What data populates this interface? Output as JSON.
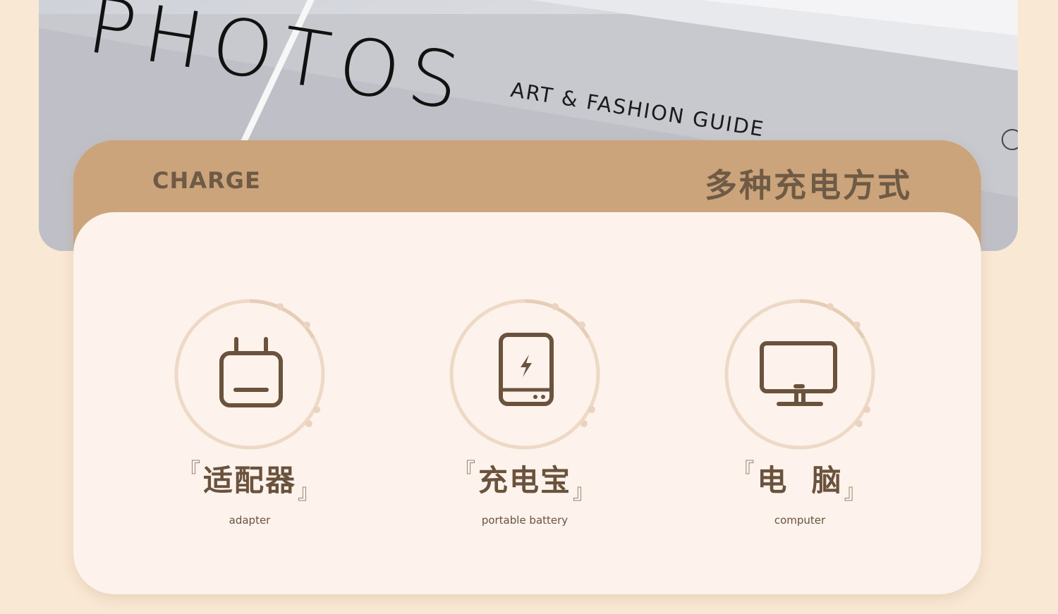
{
  "photo": {
    "title": "PHOTOS",
    "subtitle": "ART & FASHION GUIDE"
  },
  "card": {
    "header_en": "CHARGE",
    "header_cn": "多种充电方式",
    "items": [
      {
        "icon": "adapter-icon",
        "label": "适配器",
        "sub": "adapter"
      },
      {
        "icon": "power-bank-icon",
        "label": "充电宝",
        "sub": "portable battery"
      },
      {
        "icon": "computer-icon",
        "label": "电  脑",
        "sub": "computer"
      }
    ]
  },
  "colors": {
    "background": "#f9e8d4",
    "header": "#cca47c",
    "card": "#fdf3ec",
    "text": "#6a523c"
  }
}
